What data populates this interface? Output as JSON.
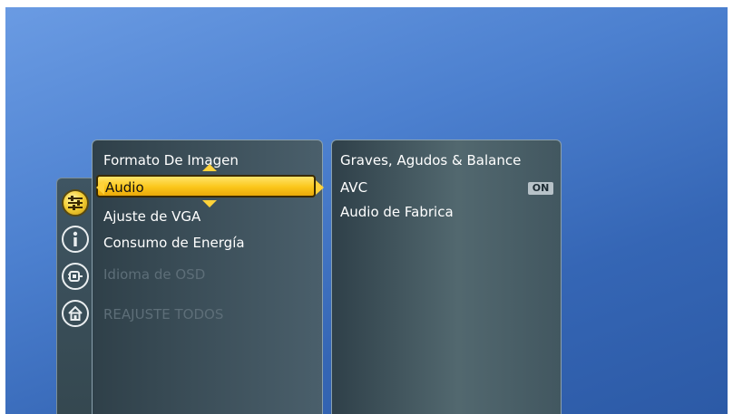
{
  "rail": {
    "icons": [
      {
        "name": "sound-settings-icon",
        "active": true
      },
      {
        "name": "info-icon",
        "active": false
      },
      {
        "name": "connection-icon",
        "active": false
      },
      {
        "name": "home-icon",
        "active": false
      }
    ]
  },
  "menu": {
    "items": [
      {
        "label": "Formato De Imagen",
        "state": "normal"
      },
      {
        "label": "Audio",
        "state": "selected"
      },
      {
        "label": "Ajuste de VGA",
        "state": "normal"
      },
      {
        "label": "Consumo de Energía",
        "state": "normal"
      },
      {
        "label": "Idioma de OSD",
        "state": "disabled"
      },
      {
        "label": "REAJUSTE TODOS",
        "state": "disabled"
      }
    ]
  },
  "submenu": {
    "items": [
      {
        "label": "Graves, Agudos & Balance"
      },
      {
        "label": "AVC",
        "value": "ON"
      },
      {
        "label": "Audio de Fabrica"
      }
    ]
  },
  "colors": {
    "background": "#4c80cf",
    "highlight": "#fbc61a",
    "panel": "#3a4d57"
  }
}
